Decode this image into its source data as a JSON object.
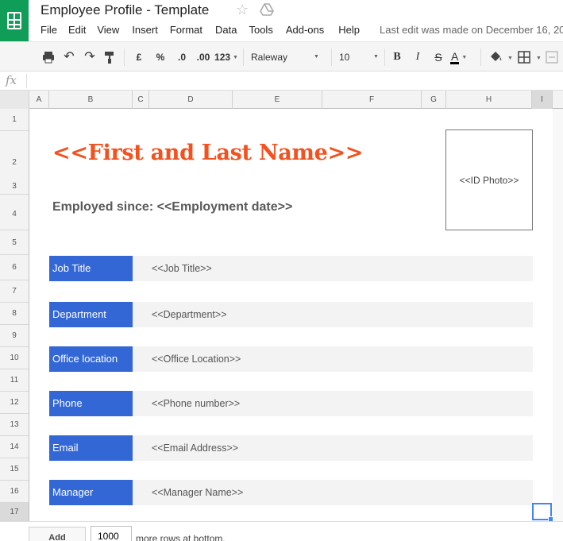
{
  "app": {
    "title": "Employee Profile - Template",
    "last_edit": "Last edit was made on December 16, 20"
  },
  "menu": [
    "File",
    "Edit",
    "View",
    "Insert",
    "Format",
    "Data",
    "Tools",
    "Add-ons",
    "Help"
  ],
  "toolbar": {
    "currency": "£",
    "percent": "%",
    "decrease_decimals": ".0",
    "increase_decimals": ".00",
    "number_format": "123",
    "font": "Raleway",
    "font_size": "10",
    "bold": "B",
    "italic": "I",
    "strikethrough": "S",
    "text_color": "A"
  },
  "formula_bar": {
    "fx_label": "fx",
    "value": ""
  },
  "columns": [
    "A",
    "B",
    "C",
    "D",
    "E",
    "F",
    "G",
    "H",
    "I"
  ],
  "rows": [
    "1",
    "2",
    "3",
    "4",
    "5",
    "6",
    "7",
    "8",
    "9",
    "10",
    "11",
    "12",
    "13",
    "14",
    "15",
    "16",
    "17"
  ],
  "profile": {
    "name_placeholder": "<<First and Last Name>>",
    "employed_since": "Employed since: <<Employment date>>",
    "photo_placeholder": "<<ID Photo>>",
    "fields": [
      {
        "label": "Job Title",
        "value": "<<Job Title>>"
      },
      {
        "label": "Department",
        "value": "<<Department>>"
      },
      {
        "label": "Office location",
        "value": "<<Office Location>>"
      },
      {
        "label": "Phone",
        "value": "<<Phone number>>"
      },
      {
        "label": "Email",
        "value": "<<Email Address>>"
      },
      {
        "label": "Manager",
        "value": "<<Manager Name>>"
      }
    ]
  },
  "footer": {
    "add_label": "Add",
    "rows_value": "1000",
    "rows_text": "more rows at bottom."
  },
  "colors": {
    "brand_green": "#0f9d58",
    "name_orange": "#f4511e",
    "label_blue": "#3367d6",
    "selection_blue": "#4285f4"
  }
}
